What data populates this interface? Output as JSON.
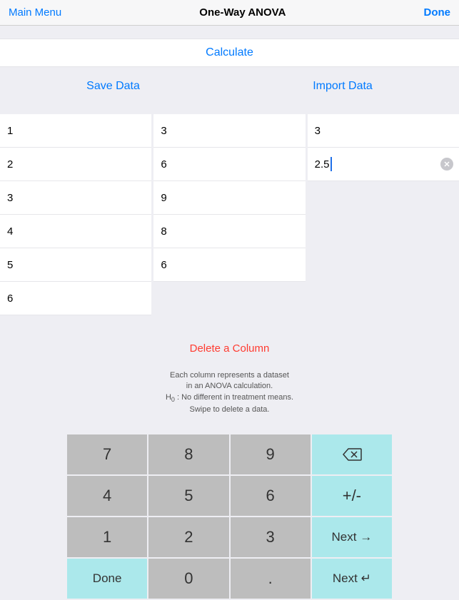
{
  "nav": {
    "left": "Main Menu",
    "title": "One-Way ANOVA",
    "right": "Done"
  },
  "calculate": "Calculate",
  "actions": {
    "save": "Save Data",
    "import": "Import Data"
  },
  "columns": [
    [
      "1",
      "2",
      "3",
      "4",
      "5",
      "6"
    ],
    [
      "3",
      "6",
      "9",
      "8",
      "6"
    ],
    [
      "3",
      "2.5"
    ]
  ],
  "editing": {
    "col": 2,
    "row": 1
  },
  "deleteColumn": "Delete a Column",
  "help": {
    "l1": "Each column represents a dataset",
    "l2": "in an ANOVA calculation.",
    "l3a": "H",
    "l3b": "0",
    "l3c": " : No different in treatment means.",
    "l4": "Swipe to delete a data."
  },
  "keypad": {
    "k7": "7",
    "k8": "8",
    "k9": "9",
    "k4": "4",
    "k5": "5",
    "k6": "6",
    "pm": "+/-",
    "k1": "1",
    "k2": "2",
    "k3": "3",
    "nextR": "Next →",
    "done": "Done",
    "k0": "0",
    "dot": ".",
    "nextE": "Next ↵"
  }
}
